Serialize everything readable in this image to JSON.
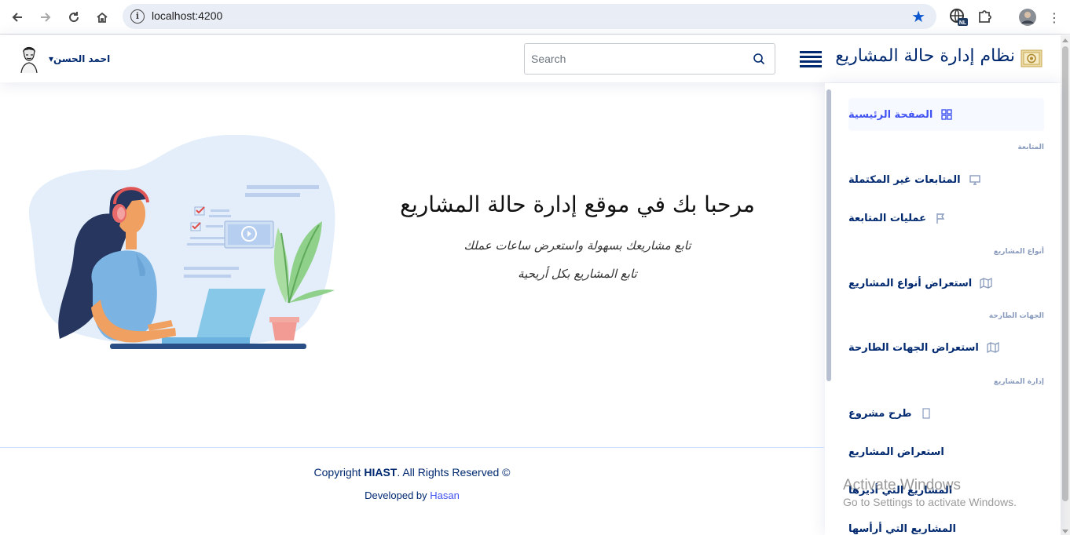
{
  "browser": {
    "url": "localhost:4200",
    "ext_badge": "NL"
  },
  "header": {
    "app_title": "نظام إدارة حالة المشاريع",
    "search_placeholder": "Search",
    "user_name": "احمد الحسن"
  },
  "sidebar": {
    "items": [
      {
        "label": "الصفحة الرئيسية",
        "icon": "grid-icon",
        "active": true
      },
      {
        "heading": "المتابعة"
      },
      {
        "label": "المتابعات غير المكتملة",
        "icon": "monitor-icon"
      },
      {
        "label": "عمليات المتابعة",
        "icon": "flag-icon"
      },
      {
        "heading": "أنواع المشاريع"
      },
      {
        "label": "استعراض أنواع المشاريع",
        "icon": "map-icon"
      },
      {
        "heading": "الجهات الطارحة"
      },
      {
        "label": "استعراض الجهات الطارحة",
        "icon": "map-icon"
      },
      {
        "heading": "إدارة المشاريع"
      },
      {
        "label": "طرح مشروع",
        "icon": "square-icon"
      },
      {
        "label": "استعراض المشاريع"
      },
      {
        "label": "المشاريع التي أديرها"
      },
      {
        "label": "المشاريع التي أرأسها"
      }
    ]
  },
  "main": {
    "welcome_title": "مرحبا بك في موقع إدارة حالة المشاريع",
    "subtitle_1": "تابع مشاريعك بسهولة واستعرض ساعات عملك",
    "subtitle_2": "تابع المشاريع بكل أريحية"
  },
  "footer": {
    "copyright_prefix": "Copyright",
    "copyright_brand": "HIAST",
    "copyright_suffix": ". All Rights Reserved ©",
    "developed_by": "Developed by",
    "developer": "Hasan"
  },
  "watermark": {
    "line1": "Activate Windows",
    "line2": "Go to Settings to activate Windows."
  },
  "colors": {
    "primary": "#012970",
    "accent": "#4154f1",
    "browser_star": "#0b57d0"
  }
}
